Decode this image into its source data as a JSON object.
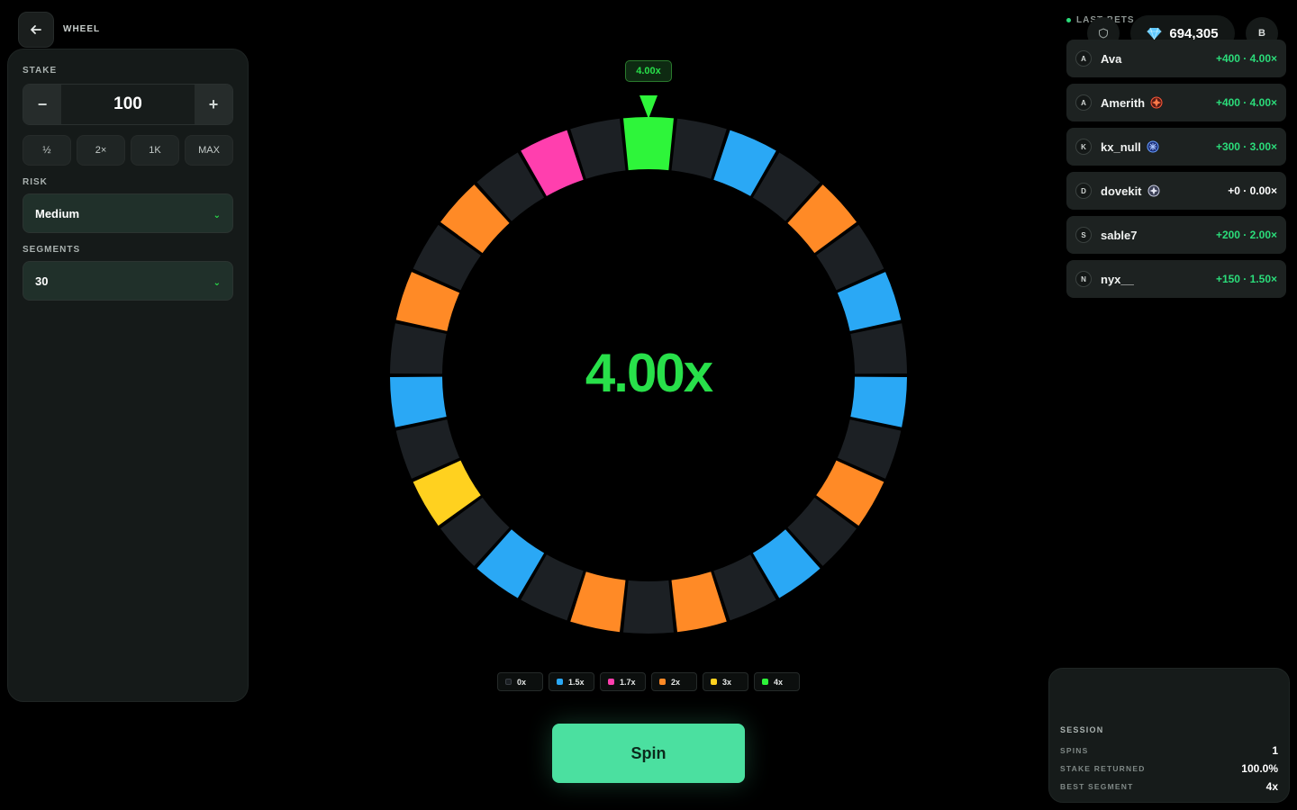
{
  "header": {
    "title": "WHEEL"
  },
  "controls": {
    "stake_label": "STAKE",
    "stake_value": "100",
    "minus": "−",
    "plus": "+",
    "quick": [
      "½",
      "2×",
      "1K",
      "MAX"
    ],
    "risk_label": "RISK",
    "risk_value": "Medium",
    "segments_label": "SEGMENTS",
    "segments_value": "30"
  },
  "wheel": {
    "result_tag": "4.00x",
    "center_multiplier": "4.00x",
    "segment_count": 30,
    "landed_segment": 0,
    "segment_colors": [
      "#2ef53a",
      "#1c2024",
      "#2aa8f5",
      "#1c2024",
      "#ff8a26",
      "#1c2024",
      "#2aa8f5",
      "#1c2024",
      "#2aa8f5",
      "#1c2024",
      "#ff8a26",
      "#1c2024",
      "#2aa8f5",
      "#1c2024",
      "#ff8a26",
      "#1c2024",
      "#ff8a26",
      "#1c2024",
      "#2aa8f5",
      "#1c2024",
      "#ffd11f",
      "#1c2024",
      "#2aa8f5",
      "#1c2024",
      "#ff8a26",
      "#1c2024",
      "#ff8a26",
      "#1c2024",
      "#ff3fae",
      "#1c2024"
    ]
  },
  "legend": [
    {
      "label": "0x",
      "color": "#1c2024"
    },
    {
      "label": "1.5x",
      "color": "#2aa8f5"
    },
    {
      "label": "1.7x",
      "color": "#ff3fae"
    },
    {
      "label": "2x",
      "color": "#ff8a26"
    },
    {
      "label": "3x",
      "color": "#ffd11f"
    },
    {
      "label": "4x",
      "color": "#2ef53a"
    }
  ],
  "spin_label": "Spin",
  "topbar": {
    "last_bets_label": "LAST BETS",
    "balance": "694,305",
    "avatar_initial": "B"
  },
  "bets": [
    {
      "initial": "A",
      "name": "Ava",
      "badge": "",
      "result": "+400 · 4.00×"
    },
    {
      "initial": "A",
      "name": "Amerith",
      "badge": "ruby-icon",
      "result": "+400 · 4.00×"
    },
    {
      "initial": "K",
      "name": "kx_null",
      "badge": "sapphire-icon",
      "result": "+300 · 3.00×"
    },
    {
      "initial": "D",
      "name": "dovekit",
      "badge": "silver-icon",
      "result": "+0 · 0.00×"
    },
    {
      "initial": "S",
      "name": "sable7",
      "badge": "",
      "result": "+200 · 2.00×"
    },
    {
      "initial": "N",
      "name": "nyx__",
      "badge": "",
      "result": "+150 · 1.50×"
    }
  ],
  "session": {
    "title": "SESSION",
    "spins_label": "SPINS",
    "spins_value": "1",
    "returned_label": "STAKE RETURNED",
    "returned_value": "100.0%",
    "best_label": "BEST SEGMENT",
    "best_value": "4x"
  }
}
